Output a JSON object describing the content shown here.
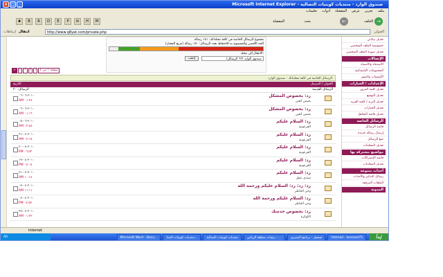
{
  "window": {
    "title": "Microsoft Internet Explorer - صندوق الوارد - منتديات كويتيات التصالية",
    "menu": [
      "ملف",
      "تحرير",
      "عرض",
      "المفضلة",
      "أدوات",
      "تعليمات"
    ]
  },
  "toolbar": {
    "back": "الخلف",
    "search": "بحث",
    "favorites": "المفضلة"
  },
  "address": {
    "label": "العنوان",
    "url": "http://www.q8yat.com/private.php",
    "go": "انتقال",
    "links": "ارتباطات"
  },
  "sidebar": [
    {
      "kind": "link",
      "text": "تعديل بياناتي"
    },
    {
      "kind": "link",
      "text": "خصوصية الملف الشخصي"
    },
    {
      "kind": "link",
      "text": "تعديل صورة الملف الشخصي"
    },
    {
      "kind": "head",
      "text": "الإتصالات"
    },
    {
      "kind": "link",
      "text": "الأصدقاء والأسماء"
    },
    {
      "kind": "link",
      "text": "المجموعات الإجتماعية"
    },
    {
      "kind": "link",
      "text": "الأوتومات والصور"
    },
    {
      "kind": "head",
      "text": "الإعدادات / الخيارات"
    },
    {
      "kind": "link",
      "text": "تعديل كلمة المرور"
    },
    {
      "kind": "link",
      "text": "تعديل التوقيع"
    },
    {
      "kind": "link",
      "text": "تعديل البريد / كلمة الفريد"
    },
    {
      "kind": "link",
      "text": "تعديل الخيارات"
    },
    {
      "kind": "link",
      "text": "تعديل قائمة التجاهل"
    },
    {
      "kind": "head",
      "text": "الرسائل الخاصة"
    },
    {
      "kind": "link",
      "text": "قائمة الرسائل"
    },
    {
      "kind": "link",
      "text": "إرسال رسالة جديدة"
    },
    {
      "kind": "link",
      "text": "تتبع الرسائل"
    },
    {
      "kind": "link",
      "text": "تعديل المجلدات"
    },
    {
      "kind": "head",
      "text": "مواضيع مشتركة بها"
    },
    {
      "kind": "link",
      "text": "قائمة الإشتراكات"
    },
    {
      "kind": "link",
      "text": "تعديل المجلدات"
    },
    {
      "kind": "head",
      "text": "أحداث متنوعة"
    },
    {
      "kind": "link",
      "text": "رسائل التذكير والأحداث"
    },
    {
      "kind": "link",
      "text": "الملفات المرفقة"
    },
    {
      "kind": "head",
      "text": "المدونة"
    }
  ],
  "notice": {
    "line1": "مجموع الرسائل الخاصة في كافة مجلداتك: ١٤١ رسالة",
    "line2": "الحد الأقصى والمسموح به للاحتفاظ بعدد الرسائل: ١٥٠ رسالة (مربع المعدل)",
    "line3": "الانتقال إلى مجلد:",
    "folder": "صندوق الوارد (٦٣ الرسائل)",
    "go": "إذهب",
    "usage": 0.94
  },
  "pager": [
    "صفحة ١ من ٤",
    "١",
    "٢",
    "٣",
    "٤",
    ">"
  ],
  "breadcrumb": "الرسائل الخاصة في كافة مجلداتك - صندوق الوارد",
  "grid": {
    "header_left": "التاريخ",
    "header_right": "العنوان / المرسل",
    "sub_left": "الرسائل: ٣٠",
    "sub_right": "الرسائل القديمة",
    "rows": [
      {
        "date": "٢٠١٠-٠٦-٠٦",
        "time": "AM ٠١:٣٨",
        "subject": "رد: بخصوص المشكل",
        "sender": "بحبس أنغين"
      },
      {
        "date": "٢٠١٠-٠٦-٠٦",
        "time": "AM ٠١:١٦",
        "subject": "رد: بخصوص المشكل",
        "sender": "بحبس أنغين"
      },
      {
        "date": "٢٠١٠-٠٦-٠٥",
        "time": "AM ٠٢:٤٥",
        "subject": "رد: السلام عليكم",
        "sender": "الفرعونية"
      },
      {
        "date": "٢٠١٠-٠٤-٢١",
        "time": "AM ٠٢:١٥",
        "subject": "رد: السلام عليكم",
        "sender": "الفرعونية"
      },
      {
        "date": "٢٠١٠-٠٤-٢٠",
        "time": "PM ٠٦:٥٣",
        "subject": "رد: السلام عليكم",
        "sender": "الفرعونية"
      },
      {
        "date": "٢٠١٠-٠٤-١٩",
        "time": "PM ٠٧:٠٥",
        "subject": "رد: السلام عليكم",
        "sender": "الفرعونية"
      },
      {
        "date": "٢٠١٠-٠٤-٢١",
        "time": "AM ١٠:١٤",
        "subject": "رد: السلام عليكم",
        "sender": "سندي عطر"
      },
      {
        "date": "٢٠١٠-٠٤-٠٥",
        "time": "AM ١١:١١",
        "subject": "رد: رد: رد: السلام عليكم ورحمة الله",
        "sender": "وحي الخاطر"
      },
      {
        "date": "٢٠١٠-٠٤-٠٤",
        "time": "PM ٠٤:٥٢",
        "subject": "رد: السلام عليكم ورحمة الله",
        "sender": "وحي الخاطر"
      },
      {
        "date": "٢٠١٠-٠٤-٢٥",
        "time": "AM ٠١:٣٢",
        "subject": "رد: بخصوص خدمتك",
        "sender": "الكوكرة"
      }
    ]
  },
  "status": {
    "text": "Internet"
  },
  "taskbar": {
    "start": "إبدأ",
    "tasks": [
      "Hotmail - loveaed75",
      "تسجيل - برنامج المصري",
      "برقيات منطقة الرياض - ...",
      "منتديات كويتيات التصالية",
      "منتديات كويتيات التصا...",
      "Microsoft Word - Docu..."
    ],
    "tray": "AR"
  }
}
